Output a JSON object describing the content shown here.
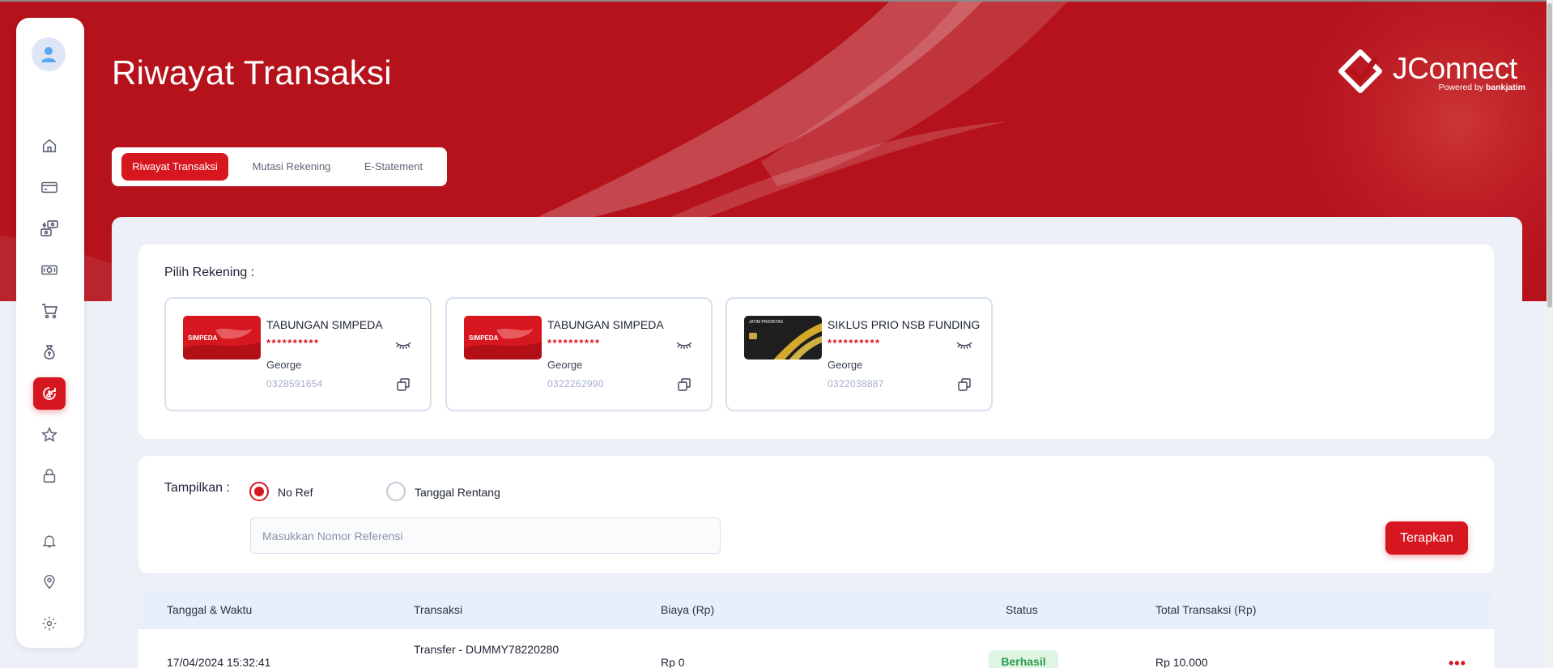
{
  "page": {
    "title": "Riwayat Transaksi"
  },
  "brand": {
    "name": "JConnect",
    "powered_by": "Powered by",
    "powered_by_bank": "bankjatim"
  },
  "sidebar": {
    "items": [
      {
        "icon": "home-icon"
      },
      {
        "icon": "card-icon"
      },
      {
        "icon": "transfer-icon"
      },
      {
        "icon": "cash-icon"
      },
      {
        "icon": "cart-icon"
      },
      {
        "icon": "money-bag-icon"
      },
      {
        "icon": "transaction-history-icon",
        "active": true
      },
      {
        "icon": "star-icon"
      },
      {
        "icon": "lock-icon"
      },
      {
        "icon": "bell-icon"
      },
      {
        "icon": "location-icon"
      },
      {
        "icon": "gear-icon"
      },
      {
        "icon": "logout-icon"
      }
    ]
  },
  "tabs": [
    {
      "label": "Riwayat Transaksi",
      "active": true
    },
    {
      "label": "Mutasi Rekening",
      "active": false
    },
    {
      "label": "E-Statement",
      "active": false
    }
  ],
  "account_section": {
    "label": "Pilih Rekening :",
    "accounts": [
      {
        "name": "TABUNGAN SIMPEDA",
        "masked": "**********",
        "owner": "George",
        "number": "0328591654",
        "card_brand": "SIMPEDA"
      },
      {
        "name": "TABUNGAN SIMPEDA",
        "masked": "**********",
        "owner": "George",
        "number": "0322262990",
        "card_brand": "SIMPEDA"
      },
      {
        "name": "SIKLUS PRIO NSB FUNDING",
        "masked": "**********",
        "owner": "George",
        "number": "0322038887",
        "card_brand": "JATIM PRIORITAS"
      }
    ]
  },
  "filter": {
    "label": "Tampilkan :",
    "options": [
      {
        "label": "No Ref",
        "checked": true
      },
      {
        "label": "Tanggal Rentang",
        "checked": false
      }
    ],
    "input_placeholder": "Masukkan Nomor Referensi",
    "input_value": "",
    "apply_label": "Terapkan"
  },
  "table": {
    "headers": [
      "Tanggal & Waktu",
      "Transaksi",
      "Biaya (Rp)",
      "Status",
      "Total Transaksi (Rp)"
    ],
    "rows": [
      {
        "datetime": "17/04/2024 15:32:41",
        "transaction": "Transfer - DUMMY78220280",
        "fee": "Rp 0",
        "status": "Berhasil",
        "total": "Rp 10.000",
        "menu": "•••"
      }
    ]
  },
  "colors": {
    "primary": "#d7171f",
    "hero": "#b5121b",
    "success": "#2a9d4a",
    "background": "#eef0f8"
  }
}
